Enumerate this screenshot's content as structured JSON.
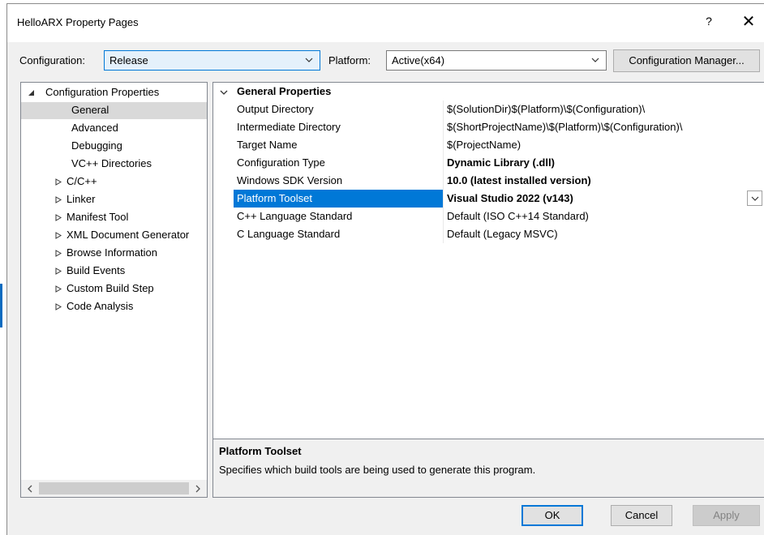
{
  "window": {
    "title": "HelloARX Property Pages",
    "help_glyph": "?",
    "close_glyph": "✕"
  },
  "toolbar": {
    "configuration_label": "Configuration:",
    "configuration_value": "Release",
    "platform_label": "Platform:",
    "platform_value": "Active(x64)",
    "config_manager_label": "Configuration Manager..."
  },
  "tree": {
    "root": "Configuration Properties",
    "children": [
      "General",
      "Advanced",
      "Debugging",
      "VC++ Directories"
    ],
    "groups": [
      "C/C++",
      "Linker",
      "Manifest Tool",
      "XML Document Generator",
      "Browse Information",
      "Build Events",
      "Custom Build Step",
      "Code Analysis"
    ],
    "selected": "General"
  },
  "properties": {
    "section": "General Properties",
    "rows": [
      {
        "name": "Output Directory",
        "value": "$(SolutionDir)$(Platform)\\$(Configuration)\\"
      },
      {
        "name": "Intermediate Directory",
        "value": "$(ShortProjectName)\\$(Platform)\\$(Configuration)\\"
      },
      {
        "name": "Target Name",
        "value": "$(ProjectName)"
      },
      {
        "name": "Configuration Type",
        "value": "Dynamic Library (.dll)"
      },
      {
        "name": "Windows SDK Version",
        "value": "10.0 (latest installed version)"
      },
      {
        "name": "Platform Toolset",
        "value": "Visual Studio 2022 (v143)"
      },
      {
        "name": "C++ Language Standard",
        "value": "Default (ISO C++14 Standard)"
      },
      {
        "name": "C Language Standard",
        "value": "Default (Legacy MSVC)"
      }
    ]
  },
  "description": {
    "title": "Platform Toolset",
    "text": "Specifies which build tools are being used to generate this program."
  },
  "buttons": {
    "ok": "OK",
    "cancel": "Cancel",
    "apply": "Apply"
  },
  "colors": {
    "accent": "#0078d7",
    "selection_gray": "#d9d9d9"
  }
}
